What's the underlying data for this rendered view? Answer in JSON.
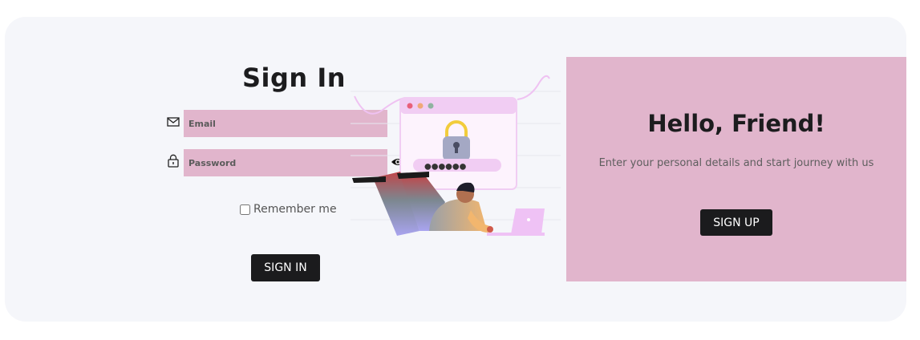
{
  "signin": {
    "title": "Sign In",
    "email_placeholder": "Email",
    "password_placeholder": "Password",
    "remember_label": "Remember me",
    "button_label": "SIGN IN",
    "icons": {
      "email": "envelope-icon",
      "password": "lock-icon",
      "toggle": "eye-icon"
    }
  },
  "illustration": {
    "password_mask": "●●●●●●",
    "icon": "padlock-icon"
  },
  "signup_panel": {
    "title": "Hello, Friend!",
    "text": "Enter your personal details and start journey with us",
    "button_label": "SIGN UP"
  },
  "colors": {
    "background": "#f5f6fa",
    "accent_pink": "#e1b5cc",
    "button_dark": "#1b1b1d",
    "text_dark": "#1c1c1e"
  }
}
